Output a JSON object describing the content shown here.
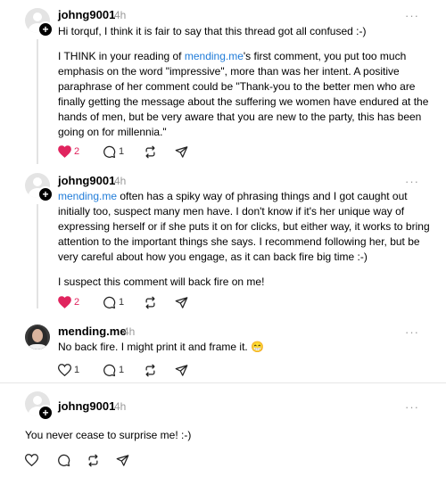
{
  "posts": [
    {
      "username": "johng9001",
      "time": "4h",
      "more": "···",
      "paragraphs": [
        {
          "before": "Hi torquf, I think it is fair to say that this thread got all confused :-)"
        },
        {
          "before": "I THINK in your reading of ",
          "mention": "mending.me",
          "after": "'s first comment, you put too much emphasis on the word \"impressive\", more than was her intent. A positive paraphrase of her comment could be \"Thank-you to the better men who are finally getting the message about the suffering we women have endured at the hands of men, but be very aware that you are new to the party, this has been going on for millennia.\""
        }
      ],
      "likes": "2",
      "replies": "1",
      "liked": true
    },
    {
      "username": "johng9001",
      "time": "4h",
      "more": "···",
      "paragraphs": [
        {
          "mention": "mending.me",
          "after": " often has a spiky way of phrasing things and I got caught out initially too, suspect many men have. I don't know if it's her unique way of expressing herself or if she puts it on for clicks, but either way, it works to bring attention to the important things she says. I recommend following her, but be very careful about how you engage, as it can back fire big time :-)"
        },
        {
          "before": "I suspect this comment will back fire on me!"
        }
      ],
      "likes": "2",
      "replies": "1",
      "liked": true
    },
    {
      "username": "mending.me",
      "time": "4h",
      "more": "···",
      "paragraphs": [
        {
          "before": "No back fire. I might print it and frame it. ",
          "emoji": "😁"
        }
      ],
      "likes": "1",
      "replies": "1",
      "liked": false
    },
    {
      "username": "johng9001",
      "time": "4h",
      "more": "···",
      "paragraphs": [
        {
          "before": "You never cease to surprise me! :-)"
        }
      ],
      "likes": "",
      "replies": "",
      "liked": false
    }
  ],
  "icons": {
    "like": "heart-icon",
    "reply": "comment-icon",
    "repost": "repost-icon",
    "share": "send-icon",
    "more": "more-options-icon",
    "follow": "plus-icon"
  },
  "colors": {
    "liked": "#e0245e",
    "mention": "#1f7bd8",
    "muted": "#999999"
  }
}
